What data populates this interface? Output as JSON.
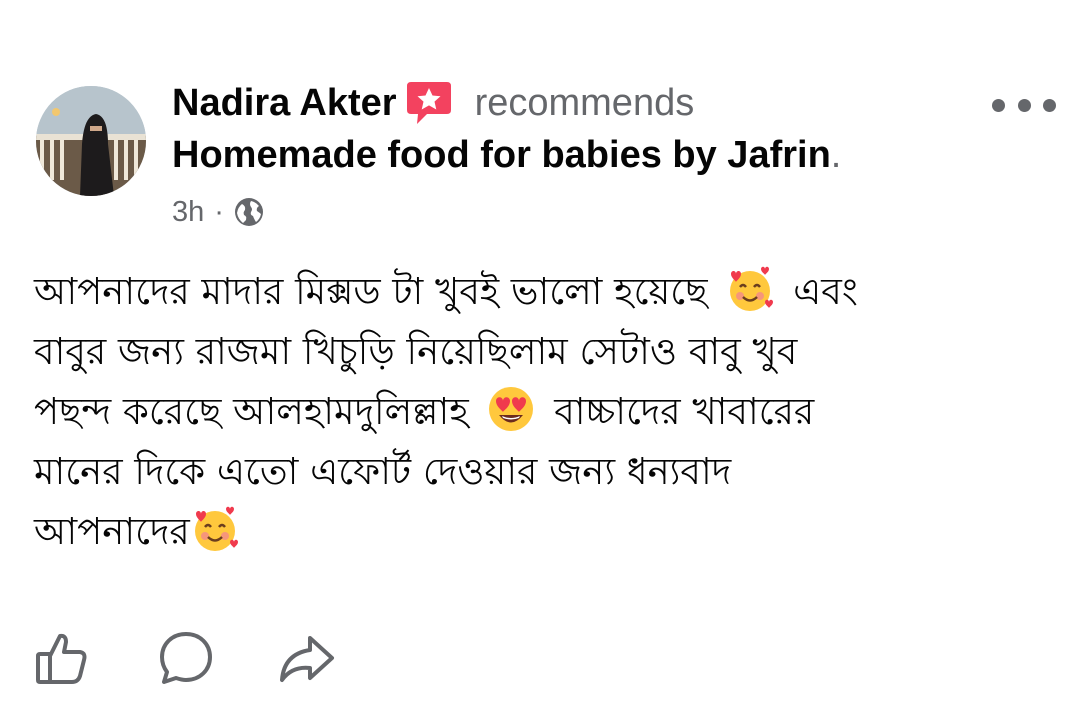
{
  "post": {
    "author": {
      "name": "Nadira Akter",
      "avatar_icon": "avatar-photo"
    },
    "action_text": "recommends",
    "recommend_icon": "recommend-star-badge-icon",
    "page": {
      "name": "Homemade food for babies by Jafrin",
      "trailing": "."
    },
    "meta": {
      "time": "3h",
      "separator": "·",
      "privacy_icon": "globe-icon"
    },
    "more_icon": "more-options-icon",
    "body": {
      "line1_a": "আপনাদের মাদার মিক্সড টা খুবই ভালো হয়েছে",
      "line1_b": "এবং",
      "line2": "বাবুর জন্য রাজমা খিচুড়ি নিয়েছিলাম সেটাও বাবু খুব",
      "line3_a": "পছন্দ করেছে আলহামদুলিল্লাহ",
      "line3_b": "বাচ্চাদের খাবারের",
      "line4": "মানের দিকে এতো এফোর্ট দেওয়ার জন্য ধন্যবাদ",
      "line5": "আপনাদের",
      "emoji_1": "smiling-face-with-hearts",
      "emoji_2": "smiling-face-with-heart-eyes",
      "emoji_3": "smiling-face-with-hearts"
    },
    "actions": {
      "like_icon": "like-icon",
      "comment_icon": "comment-icon",
      "share_icon": "share-icon"
    }
  },
  "colors": {
    "primary_text": "#050505",
    "secondary_text": "#65676b",
    "recommend_badge": "#f3425f",
    "emoji_face": "#ffc83d",
    "heart": "#f03a4d"
  }
}
